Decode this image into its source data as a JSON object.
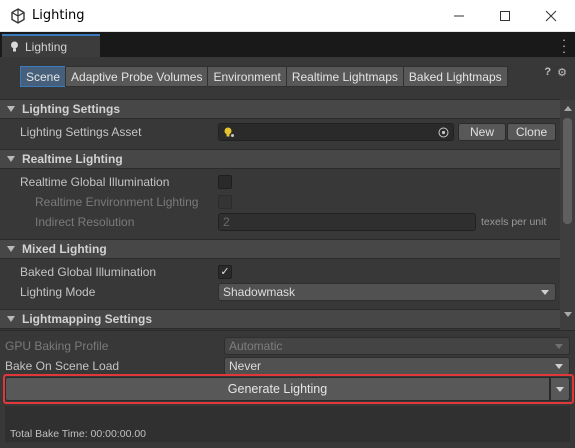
{
  "window": {
    "title": "Lighting",
    "controls": {
      "minimize": "—",
      "maximize": "☐",
      "close": "✕"
    }
  },
  "tab": {
    "label": "Lighting",
    "icon": "lightbulb-icon"
  },
  "subtabs": [
    {
      "label": "Scene",
      "active": true
    },
    {
      "label": "Adaptive Probe Volumes",
      "active": false
    },
    {
      "label": "Environment",
      "active": false
    },
    {
      "label": "Realtime Lightmaps",
      "active": false
    },
    {
      "label": "Baked Lightmaps",
      "active": false
    }
  ],
  "header_icons": {
    "help": "?",
    "settings": "⚙"
  },
  "sections": {
    "lighting_settings": {
      "title": "Lighting Settings",
      "asset_label": "Lighting Settings Asset",
      "asset_value": "",
      "new_button": "New",
      "clone_button": "Clone"
    },
    "realtime_lighting": {
      "title": "Realtime Lighting",
      "rgi_label": "Realtime Global Illumination",
      "rgi_checked": false,
      "env_label": "Realtime Environment Lighting",
      "env_checked": false,
      "indirect_label": "Indirect Resolution",
      "indirect_value": "2",
      "indirect_unit": "texels per unit"
    },
    "mixed_lighting": {
      "title": "Mixed Lighting",
      "bgi_label": "Baked Global Illumination",
      "bgi_checked": true,
      "check_glyph": "✓",
      "mode_label": "Lighting Mode",
      "mode_value": "Shadowmask"
    },
    "lightmapping": {
      "title": "Lightmapping Settings"
    }
  },
  "bottom": {
    "gpu_label": "GPU Baking Profile",
    "gpu_value": "Automatic",
    "bake_on_load_label": "Bake On Scene Load",
    "bake_on_load_value": "Never",
    "generate_button": "Generate Lighting",
    "total_bake_time": "Total Bake Time: 00:00:00.00"
  },
  "colors": {
    "highlight_border": "#e0373a",
    "active_tab_accent": "#3a79bb"
  }
}
